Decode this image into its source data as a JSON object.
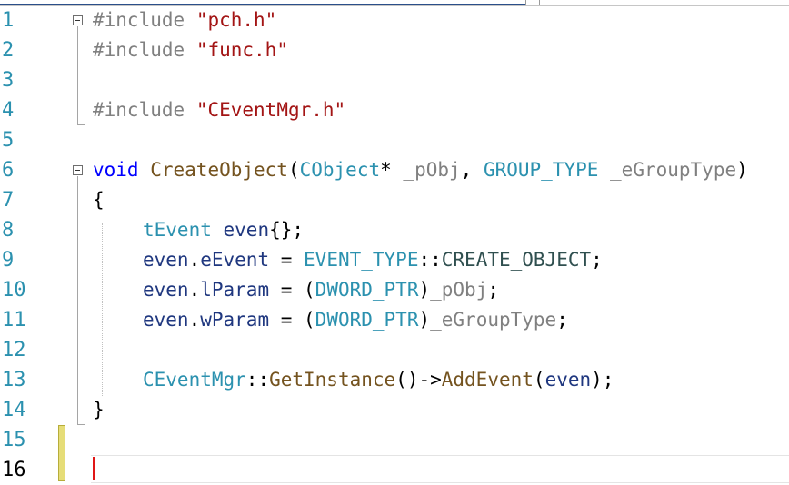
{
  "editor": {
    "language": "C++",
    "colors": {
      "keyword": "#0000ff",
      "preprocessor": "#808080",
      "string": "#a31515",
      "type": "#2b91af",
      "parameter": "#808080",
      "function": "#74531f",
      "variable": "#1f377f",
      "line_number": "#2b91af",
      "change_bar": "#e6dd78",
      "caret": "#e01616"
    },
    "lines": [
      {
        "n": "1"
      },
      {
        "n": "2"
      },
      {
        "n": "3"
      },
      {
        "n": "4"
      },
      {
        "n": "5"
      },
      {
        "n": "6"
      },
      {
        "n": "7"
      },
      {
        "n": "8"
      },
      {
        "n": "9"
      },
      {
        "n": "10"
      },
      {
        "n": "11"
      },
      {
        "n": "12"
      },
      {
        "n": "13"
      },
      {
        "n": "14"
      },
      {
        "n": "15"
      },
      {
        "n": "16"
      }
    ],
    "tokens": {
      "l1_pp": "#include",
      "l1_str": "\"pch.h\"",
      "l2_pp": "#include",
      "l2_str": "\"func.h\"",
      "l4_pp": "#include",
      "l4_str": "\"CEventMgr.h\"",
      "l6_kw": "void",
      "l6_fn": "CreateObject",
      "l6_p1": "(",
      "l6_type1": "CObject",
      "l6_p2": "* ",
      "l6_param1": "_pObj",
      "l6_p3": ", ",
      "l6_type2": "GROUP_TYPE",
      "l6_p4": " ",
      "l6_param2": "_eGroupType",
      "l6_p5": ")",
      "l7_brace": "{",
      "l8_type": "tEvent",
      "l8_var": "even",
      "l8_rest": "{};",
      "l9_var": "even",
      "l9_dot": ".",
      "l9_member": "eEvent",
      "l9_eq": " = ",
      "l9_type": "EVENT_TYPE",
      "l9_scope": "::",
      "l9_enum": "CREATE_OBJECT",
      "l9_end": ";",
      "l10_var": "even",
      "l10_dot": ".",
      "l10_member": "lParam",
      "l10_eq": " = (",
      "l10_type": "DWORD_PTR",
      "l10_cl": ")",
      "l10_param": "_pObj",
      "l10_end": ";",
      "l11_var": "even",
      "l11_dot": ".",
      "l11_member": "wParam",
      "l11_eq": " = (",
      "l11_type": "DWORD_PTR",
      "l11_cl": ")",
      "l11_param": "_eGroupType",
      "l11_end": ";",
      "l13_type": "CEventMgr",
      "l13_scope": "::",
      "l13_fn1": "GetInstance",
      "l13_mid": "()->",
      "l13_fn2": "AddEvent",
      "l13_p1": "(",
      "l13_var": "even",
      "l13_end": ");",
      "l14_brace": "}"
    }
  }
}
